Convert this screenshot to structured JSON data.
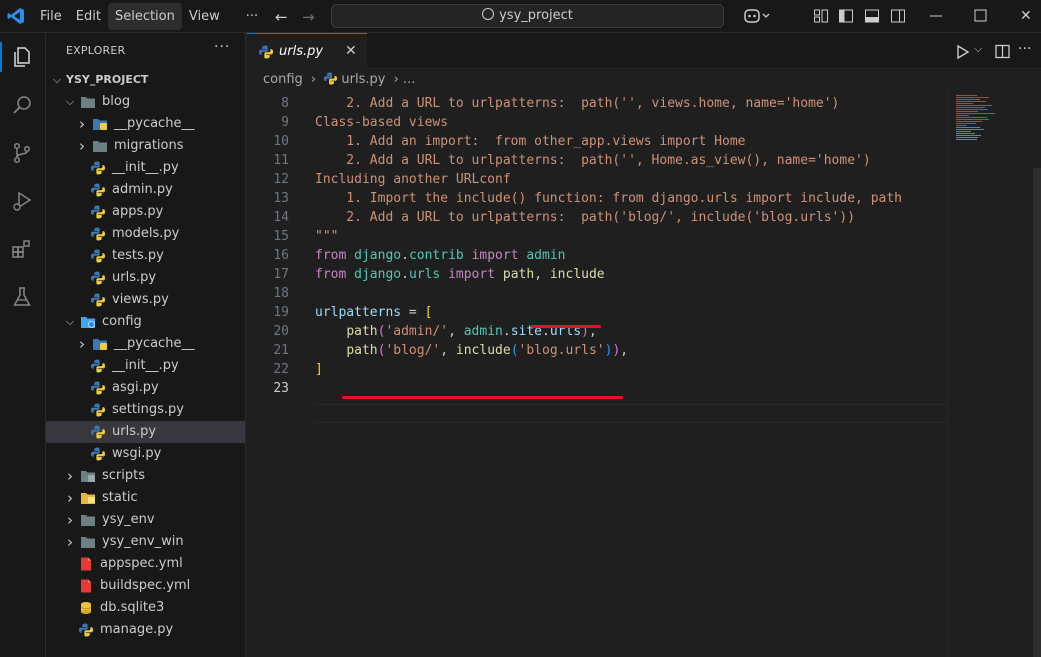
{
  "menu": [
    "File",
    "Edit",
    "Selection",
    "View",
    "···"
  ],
  "search": {
    "text": "ysy_project"
  },
  "sidebar": {
    "title": "EXPLORER",
    "more": "···",
    "project": "YSY_PROJECT",
    "items": [
      {
        "label": "blog",
        "kind": "folder-open",
        "depth": 1
      },
      {
        "label": "__pycache__",
        "kind": "folder-py",
        "depth": 2
      },
      {
        "label": "migrations",
        "kind": "folder",
        "depth": 2
      },
      {
        "label": "__init__.py",
        "kind": "py",
        "depth": 2
      },
      {
        "label": "admin.py",
        "kind": "py",
        "depth": 2
      },
      {
        "label": "apps.py",
        "kind": "py",
        "depth": 2
      },
      {
        "label": "models.py",
        "kind": "py",
        "depth": 2
      },
      {
        "label": "tests.py",
        "kind": "py",
        "depth": 2
      },
      {
        "label": "urls.py",
        "kind": "py",
        "depth": 2
      },
      {
        "label": "views.py",
        "kind": "py",
        "depth": 2
      },
      {
        "label": "config",
        "kind": "folder-config",
        "depth": 1
      },
      {
        "label": "__pycache__",
        "kind": "folder-py",
        "depth": 2
      },
      {
        "label": "__init__.py",
        "kind": "py",
        "depth": 2
      },
      {
        "label": "asgi.py",
        "kind": "py",
        "depth": 2
      },
      {
        "label": "settings.py",
        "kind": "py",
        "depth": 2
      },
      {
        "label": "urls.py",
        "kind": "py",
        "depth": 2,
        "selected": true
      },
      {
        "label": "wsgi.py",
        "kind": "py",
        "depth": 2
      },
      {
        "label": "scripts",
        "kind": "folder-scripts",
        "depth": 1
      },
      {
        "label": "static",
        "kind": "folder-static",
        "depth": 1
      },
      {
        "label": "ysy_env",
        "kind": "folder",
        "depth": 1
      },
      {
        "label": "ysy_env_win",
        "kind": "folder",
        "depth": 1
      },
      {
        "label": "appspec.yml",
        "kind": "yml",
        "depth": 1
      },
      {
        "label": "buildspec.yml",
        "kind": "yml",
        "depth": 1
      },
      {
        "label": "db.sqlite3",
        "kind": "db",
        "depth": 1
      },
      {
        "label": "manage.py",
        "kind": "py",
        "depth": 1
      }
    ]
  },
  "tab": {
    "label": "urls.py",
    "close": "✕"
  },
  "breadcrumb": {
    "folder": "config",
    "sep": "›",
    "file": "urls.py",
    "tail": "›  ..."
  },
  "code": {
    "current_line": 23,
    "lines": [
      {
        "n": "8",
        "tokens": [
          [
            "t-str",
            "    2. Add a URL to urlpatterns:  path('', views.home, name='home')"
          ]
        ]
      },
      {
        "n": "9",
        "tokens": [
          [
            "t-str",
            "Class-based views"
          ]
        ]
      },
      {
        "n": "10",
        "tokens": [
          [
            "t-str",
            "    1. Add an import:  from other_app.views import Home"
          ]
        ]
      },
      {
        "n": "11",
        "tokens": [
          [
            "t-str",
            "    2. Add a URL to urlpatterns:  path('', Home.as_view(), name='home')"
          ]
        ]
      },
      {
        "n": "12",
        "tokens": [
          [
            "t-str",
            "Including another URLconf"
          ]
        ]
      },
      {
        "n": "13",
        "tokens": [
          [
            "t-str",
            "    1. Import the include() function: from django.urls import include, path"
          ]
        ]
      },
      {
        "n": "14",
        "tokens": [
          [
            "t-str",
            "    2. Add a URL to urlpatterns:  path('blog/', include('blog.urls'))"
          ]
        ]
      },
      {
        "n": "15",
        "tokens": [
          [
            "t-str",
            "\"\"\""
          ]
        ]
      },
      {
        "n": "16",
        "tokens": [
          [
            "t-kw",
            "from"
          ],
          [
            "t-pl",
            " "
          ],
          [
            "t-mod",
            "django"
          ],
          [
            "t-pl",
            "."
          ],
          [
            "t-mod",
            "contrib"
          ],
          [
            "t-pl",
            " "
          ],
          [
            "t-kw",
            "import"
          ],
          [
            "t-pl",
            " "
          ],
          [
            "t-mod",
            "admin"
          ]
        ]
      },
      {
        "n": "17",
        "tokens": [
          [
            "t-kw",
            "from"
          ],
          [
            "t-pl",
            " "
          ],
          [
            "t-mod",
            "django"
          ],
          [
            "t-pl",
            "."
          ],
          [
            "t-mod",
            "urls"
          ],
          [
            "t-pl",
            " "
          ],
          [
            "t-kw",
            "import"
          ],
          [
            "t-pl",
            " "
          ],
          [
            "t-fn",
            "path"
          ],
          [
            "t-pl",
            ", "
          ],
          [
            "t-fn",
            "include"
          ]
        ]
      },
      {
        "n": "18",
        "tokens": []
      },
      {
        "n": "19",
        "tokens": [
          [
            "t-var",
            "urlpatterns"
          ],
          [
            "t-pl",
            " = "
          ],
          [
            "t-br1",
            "["
          ]
        ]
      },
      {
        "n": "20",
        "tokens": [
          [
            "t-pl",
            "    "
          ],
          [
            "t-fn",
            "path"
          ],
          [
            "t-br2",
            "("
          ],
          [
            "t-str",
            "'admin/'"
          ],
          [
            "t-pl",
            ", "
          ],
          [
            "t-mod",
            "admin"
          ],
          [
            "t-pl",
            "."
          ],
          [
            "t-var",
            "site"
          ],
          [
            "t-pl",
            "."
          ],
          [
            "t-var",
            "urls"
          ],
          [
            "t-br2",
            ")"
          ],
          [
            "t-pl",
            ","
          ]
        ]
      },
      {
        "n": "21",
        "tokens": [
          [
            "t-pl",
            "    "
          ],
          [
            "t-fn",
            "path"
          ],
          [
            "t-br2",
            "("
          ],
          [
            "t-str",
            "'blog/'"
          ],
          [
            "t-pl",
            ", "
          ],
          [
            "t-fn",
            "include"
          ],
          [
            "t-br3",
            "("
          ],
          [
            "t-str",
            "'blog.urls'"
          ],
          [
            "t-br3",
            ")"
          ],
          [
            "t-br2",
            ")"
          ],
          [
            "t-pl",
            ","
          ]
        ]
      },
      {
        "n": "22",
        "tokens": [
          [
            "t-br1",
            "]"
          ]
        ]
      },
      {
        "n": "23",
        "tokens": []
      }
    ]
  },
  "colors": {
    "accent": "#0078d4",
    "annotation": "#e81123"
  }
}
